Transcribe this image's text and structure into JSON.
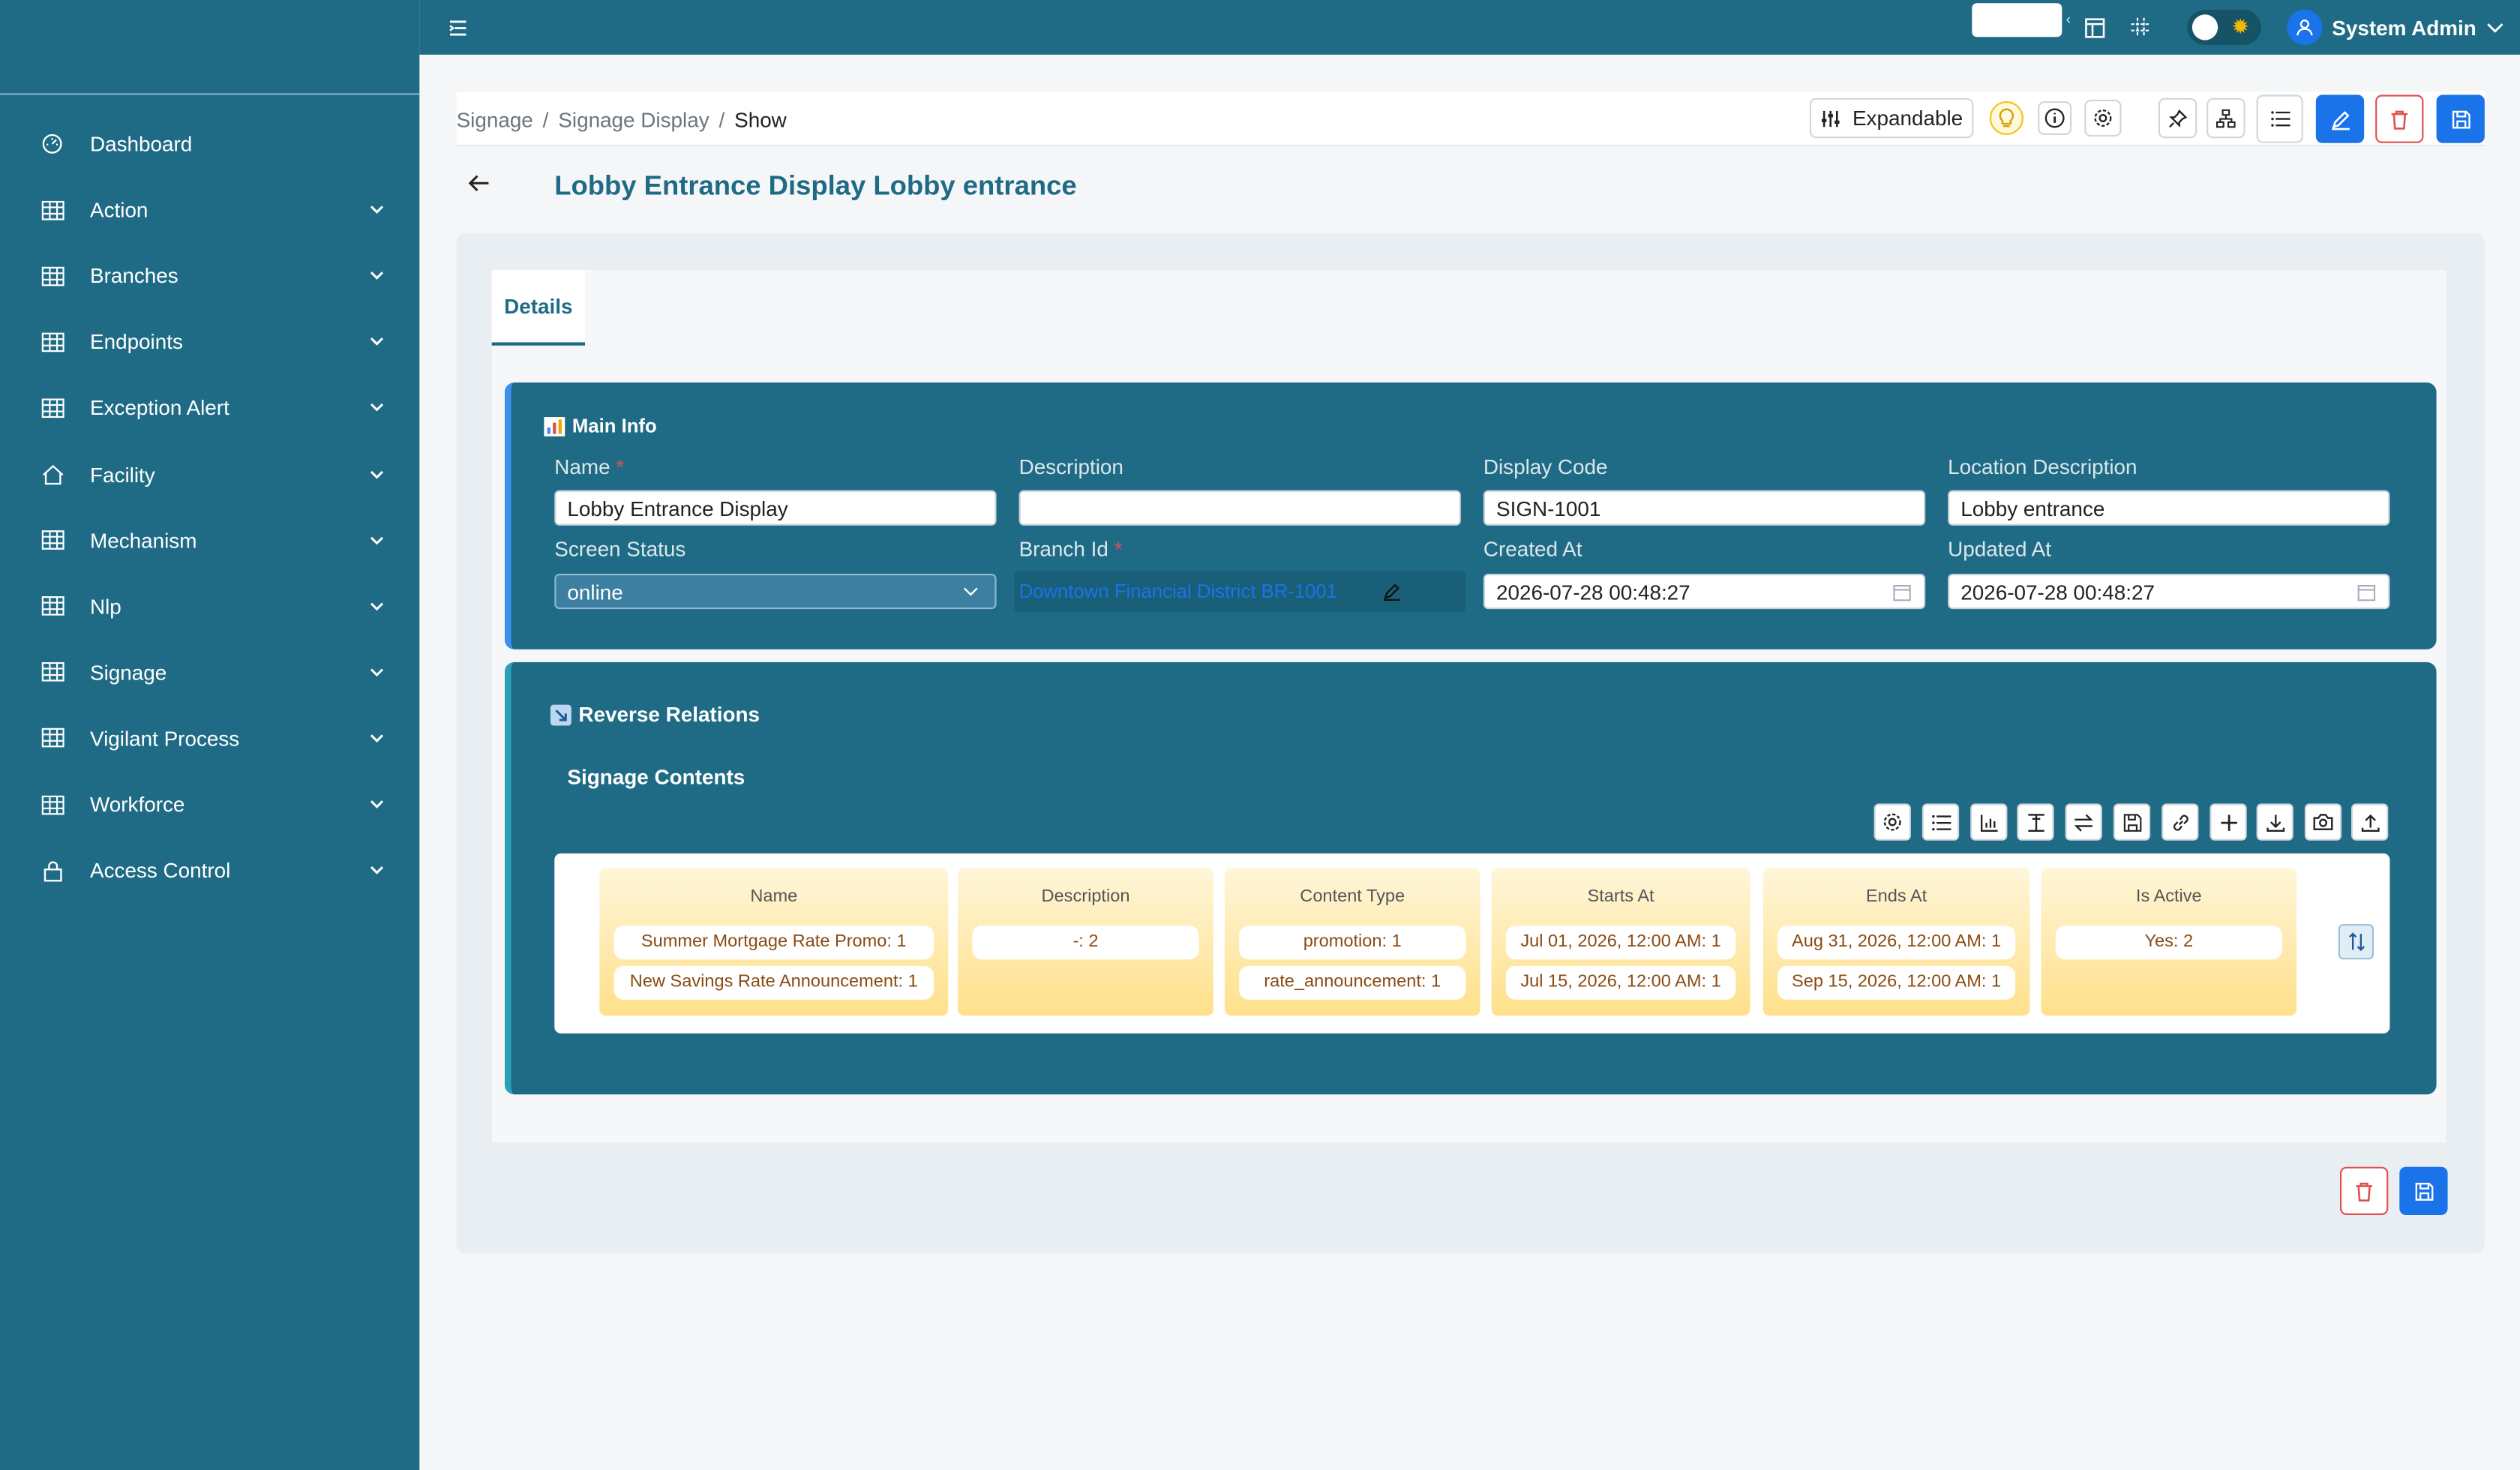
{
  "sidebar": {
    "items": [
      {
        "label": "Dashboard",
        "icon": "dashboard-icon"
      },
      {
        "label": "Action",
        "icon": "table-icon"
      },
      {
        "label": "Branches",
        "icon": "table-icon"
      },
      {
        "label": "Endpoints",
        "icon": "table-icon"
      },
      {
        "label": "Exception Alert",
        "icon": "table-icon"
      },
      {
        "label": "Facility",
        "icon": "home-icon"
      },
      {
        "label": "Mechanism",
        "icon": "table-icon"
      },
      {
        "label": "Nlp",
        "icon": "table-icon"
      },
      {
        "label": "Signage",
        "icon": "table-icon"
      },
      {
        "label": "Vigilant Process",
        "icon": "table-icon"
      },
      {
        "label": "Workforce",
        "icon": "table-icon"
      },
      {
        "label": "Access Control",
        "icon": "lock-icon"
      }
    ]
  },
  "topbar": {
    "user_name": "System Admin"
  },
  "breadcrumb": {
    "items": [
      "Signage",
      "Signage Display"
    ],
    "current": "Show"
  },
  "toolbar": {
    "expandable_label": "Expandable"
  },
  "page": {
    "title": "Lobby Entrance Display Lobby entrance"
  },
  "tabs": {
    "details": "Details"
  },
  "main_info": {
    "title": "Main Info",
    "fields": {
      "name": {
        "label": "Name",
        "value": "Lobby Entrance Display"
      },
      "description": {
        "label": "Description",
        "value": ""
      },
      "display_code": {
        "label": "Display Code",
        "value": "SIGN-1001"
      },
      "location_description": {
        "label": "Location Description",
        "value": "Lobby entrance"
      },
      "screen_status": {
        "label": "Screen Status",
        "value": "online"
      },
      "branch_id": {
        "label": "Branch Id",
        "value": "Downtown Financial District BR-1001"
      },
      "created_at": {
        "label": "Created At",
        "value": "2026-07-28 00:48:27"
      },
      "updated_at": {
        "label": "Updated At",
        "value": "2026-07-28 00:48:27"
      }
    }
  },
  "reverse_relations": {
    "title": "Reverse Relations",
    "subtitle": "Signage Contents",
    "columns": [
      {
        "header": "Name",
        "chips": [
          "Summer Mortgage Rate Promo: 1",
          "New Savings Rate Announcement: 1"
        ]
      },
      {
        "header": "Description",
        "chips": [
          "-: 2"
        ]
      },
      {
        "header": "Content Type",
        "chips": [
          "promotion: 1",
          "rate_announcement: 1"
        ]
      },
      {
        "header": "Starts At",
        "chips": [
          "Jul 01, 2026, 12:00 AM: 1",
          "Jul 15, 2026, 12:00 AM: 1"
        ]
      },
      {
        "header": "Ends At",
        "chips": [
          "Aug 31, 2026, 12:00 AM: 1",
          "Sep 15, 2026, 12:00 AM: 1"
        ]
      },
      {
        "header": "Is Active",
        "chips": [
          "Yes: 2"
        ]
      }
    ]
  },
  "colors": {
    "primary": "#1f6b85",
    "accent": "#1a73e8",
    "danger": "#e04f4f",
    "chip_bg": "#ffe08a"
  }
}
